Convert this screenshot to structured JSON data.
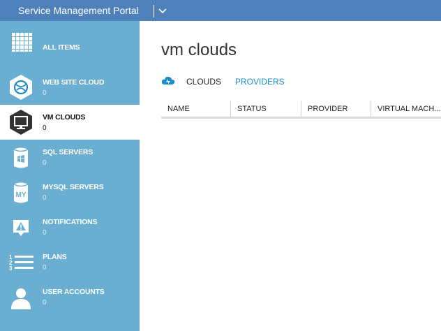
{
  "header": {
    "title": "Service Management Portal"
  },
  "sidebar": {
    "items": [
      {
        "id": "all-items",
        "label": "ALL ITEMS",
        "count": "",
        "icon": "grid-icon"
      },
      {
        "id": "web-site-cloud",
        "label": "WEB SITE CLOUD",
        "count": "0",
        "icon": "globe-icon"
      },
      {
        "id": "vm-clouds",
        "label": "VM CLOUDS",
        "count": "0",
        "icon": "monitor-icon"
      },
      {
        "id": "sql-servers",
        "label": "SQL SERVERS",
        "count": "0",
        "icon": "database-icon"
      },
      {
        "id": "mysql-servers",
        "label": "MYSQL SERVERS",
        "count": "0",
        "icon": "mysql-database-icon"
      },
      {
        "id": "notifications",
        "label": "NOTIFICATIONS",
        "count": "0",
        "icon": "warning-bubble-icon"
      },
      {
        "id": "plans",
        "label": "PLANS",
        "count": "0",
        "icon": "numbered-list-icon"
      },
      {
        "id": "user-accounts",
        "label": "USER ACCOUNTS",
        "count": "0",
        "icon": "user-icon"
      }
    ],
    "selected": "vm-clouds"
  },
  "main": {
    "title": "vm clouds",
    "tabs": [
      {
        "label": "CLOUDS",
        "active": true
      },
      {
        "label": "PROVIDERS",
        "active": false
      }
    ],
    "table": {
      "columns": [
        "NAME",
        "STATUS",
        "PROVIDER",
        "VIRTUAL MACH..."
      ]
    }
  },
  "colors": {
    "topbar": "#4e81b9",
    "sidebar": "#6aaed2",
    "link": "#1a8dc9",
    "icon_hex": "#1f8ac6",
    "icon_selected_hex": "#333333"
  }
}
